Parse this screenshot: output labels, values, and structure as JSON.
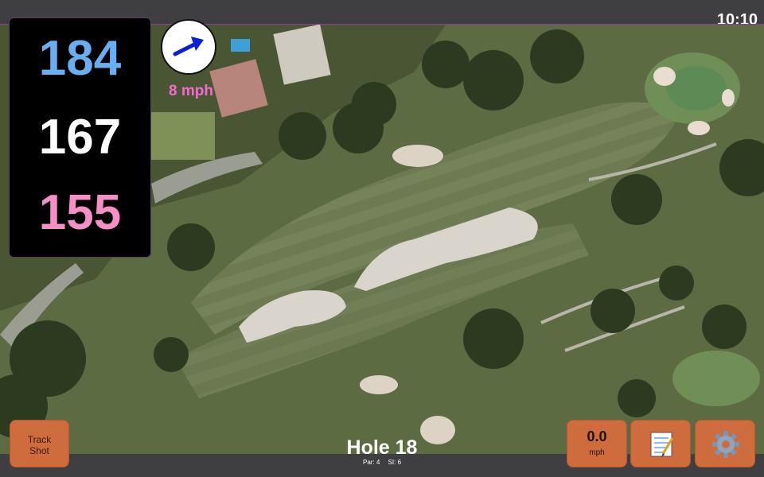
{
  "status": {
    "time": "10:10"
  },
  "distances": {
    "back": "184",
    "middle": "167",
    "front": "155",
    "colors": {
      "back": "#6aaef2",
      "middle": "#ffffff",
      "front": "#f58fc6"
    }
  },
  "wind": {
    "speed_label": "8 mph",
    "direction_icon": "arrow-icon",
    "color": "#0a1fd8",
    "label_color": "#f26ad2"
  },
  "hole": {
    "title": "Hole 18",
    "par": "Par: 4",
    "si": "SI: 6"
  },
  "buttons": {
    "track_line1": "Track",
    "track_line2": "Shot",
    "speed_value": "0.0",
    "speed_unit": "mph",
    "notes_icon": "notepad-icon",
    "settings_icon": "gear-icon",
    "accent": "#cf6c3d"
  }
}
